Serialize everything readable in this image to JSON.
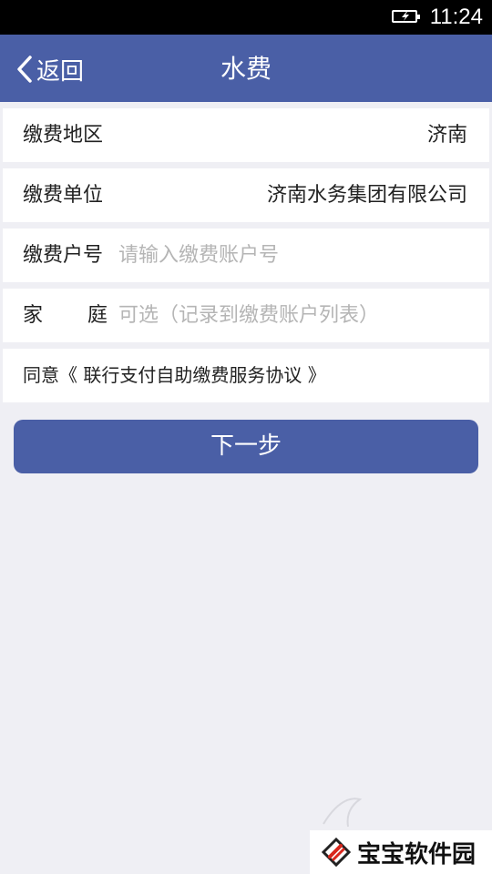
{
  "status_bar": {
    "time": "11:24"
  },
  "nav": {
    "back_label": "返回",
    "title": "水费"
  },
  "form": {
    "region": {
      "label": "缴费地区",
      "value": "济南"
    },
    "unit": {
      "label": "缴费单位",
      "value": "济南水务集团有限公司"
    },
    "account": {
      "label": "缴费户号",
      "placeholder": "请输入缴费账户号",
      "value": ""
    },
    "family": {
      "label_1": "家",
      "label_2": "庭",
      "placeholder": "可选（记录到缴费账户列表）",
      "value": ""
    },
    "agreement": {
      "text": "同意《 联行支付自助缴费服务协议 》"
    }
  },
  "next_button_label": "下一步",
  "watermark": {
    "text": "宝宝软件园"
  },
  "colors": {
    "primary": "#4a5fa6",
    "background": "#efeff4",
    "placeholder": "#b5b5b5"
  }
}
